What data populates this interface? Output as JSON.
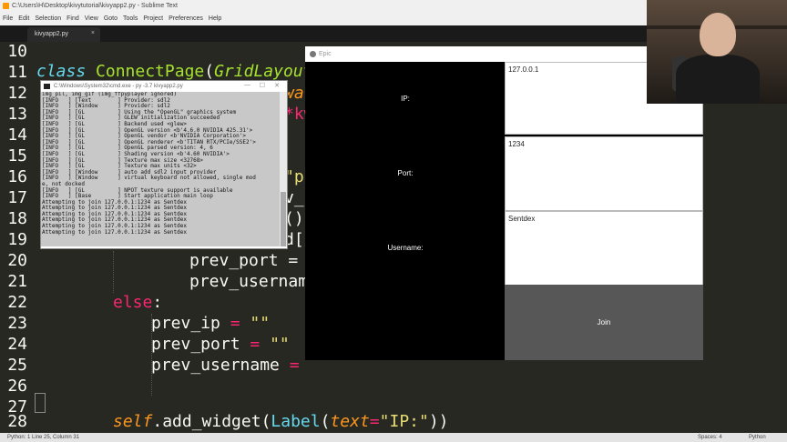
{
  "window": {
    "title": "C:\\Users\\H\\Desktop\\kivytutorial\\kivyapp2.py - Sublime Text"
  },
  "menu": [
    "File",
    "Edit",
    "Selection",
    "Find",
    "View",
    "Goto",
    "Tools",
    "Project",
    "Preferences",
    "Help"
  ],
  "tab": {
    "label": "kivyapp2.py",
    "close": "×"
  },
  "editor": {
    "line_numbers": [
      "10",
      "11",
      "12",
      "13",
      "14",
      "15",
      "16",
      "17",
      "18",
      "19",
      "20",
      "21",
      "22",
      "23",
      "24",
      "25",
      "26",
      "27",
      "28"
    ],
    "code": {
      "l10_kw": "class",
      "l10_name": "ConnectPage",
      "l10_paren": "(",
      "l10_base": "GridLayout",
      "l12_frag": "wa",
      "l13_frag": "*kw",
      "l16_frag": "\"p",
      "l17_frag": "v_",
      "l18_frag": "()",
      "l19_frag": "d[",
      "l20_code": "prev_port = ",
      "l21_code": "prev_usernam",
      "l22_else": "else",
      "l22_colon": ":",
      "l23_var": "prev_ip",
      "l23_op": " = ",
      "l23_str": "\"\"",
      "l24_var": "prev_port",
      "l24_op": " = ",
      "l24_str": "\"\"",
      "l25_var": "prev_username",
      "l25_op": " = ",
      "l28_self": "self",
      "l28_call": ".add_widget(",
      "l28_label": "Label",
      "l28_open": "(",
      "l28_arg": "text",
      "l28_eq": "=",
      "l28_str": "\"IP:\"",
      "l28_close": "))"
    }
  },
  "cmd": {
    "title": "C:\\Windows\\System32\\cmd.exe - py -3.7 kivyapp2.py",
    "lines": [
      "img_pil, img_gif (img_ffpyplayer ignored)",
      "[INFO   ] [Text        ] Provider: sdl2",
      "[INFO   ] [Window      ] Provider: sdl2",
      "[INFO   ] [GL          ] Using the \"OpenGL\" graphics system",
      "[INFO   ] [GL          ] GLEW initialization succeeded",
      "[INFO   ] [GL          ] Backend used <glew>",
      "[INFO   ] [GL          ] OpenGL version <b'4.6.0 NVIDIA 425.31'>",
      "[INFO   ] [GL          ] OpenGL vendor <b'NVIDIA Corporation'>",
      "[INFO   ] [GL          ] OpenGL renderer <b'TITAN RTX/PCIe/SSE2'>",
      "",
      "[INFO   ] [GL          ] OpenGL parsed version: 4, 6",
      "[INFO   ] [GL          ] Shading version <b'4.60 NVIDIA'>",
      "[INFO   ] [GL          ] Texture max size <32768>",
      "[INFO   ] [GL          ] Texture max units <32>",
      "[INFO   ] [Window      ] auto add sdl2 input provider",
      "[INFO   ] [Window      ] virtual keyboard not allowed, single mod",
      "e, not docked",
      "[INFO   ] [GL          ] NPOT texture support is available",
      "[INFO   ] [Base        ] Start application main loop",
      "Attempting to join 127.0.0.1:1234 as Sentdex",
      "Attempting to join 127.0.0.1:1234 as Sentdex",
      "Attempting to join 127.0.0.1:1234 as Sentdex",
      "Attempting to join 127.0.0.1:1234 as Sentdex",
      "Attempting to join 127.0.0.1:1234 as Sentdex",
      "Attempting to join 127.0.0.1:1234 as Sentdex"
    ]
  },
  "kivy": {
    "title": "Epic",
    "close": "×",
    "ip_label": "IP:",
    "ip_value": "127.0.0.1",
    "port_label": "Port:",
    "port_value": "1234",
    "username_label": "Username:",
    "username_value": "Sentdex",
    "join_label": "Join"
  },
  "status": {
    "left": "Python: 1 Line 25, Column 31",
    "spaces": "Spaces: 4",
    "syntax": "Python"
  },
  "colors": {
    "editor_bg": "#272822",
    "keyword": "#66d9ef",
    "class_name": "#a6e22e",
    "operator": "#f92672",
    "string": "#e6db74",
    "argument": "#fd971f"
  }
}
